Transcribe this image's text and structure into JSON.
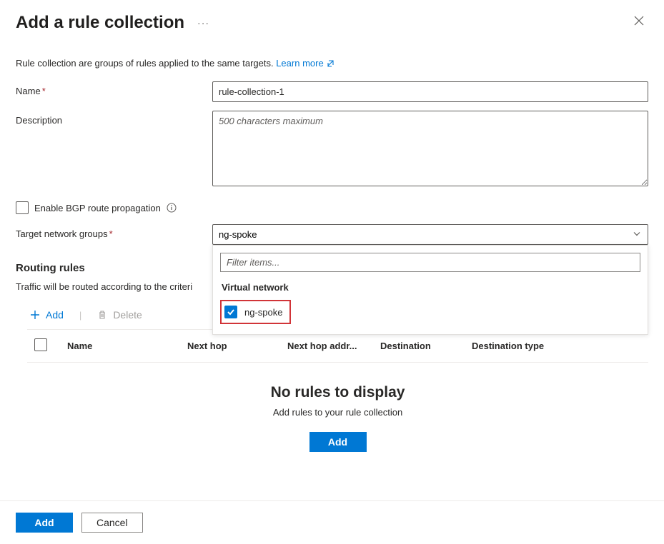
{
  "header": {
    "title": "Add a rule collection"
  },
  "intro": {
    "text": "Rule collection are groups of rules applied to the same targets. ",
    "learn_more": "Learn more"
  },
  "form": {
    "name_label": "Name",
    "name_value": "rule-collection-1",
    "desc_label": "Description",
    "desc_placeholder": "500 characters maximum",
    "bgp_label": "Enable BGP route propagation",
    "target_label": "Target network groups",
    "target_value": "ng-spoke"
  },
  "dropdown": {
    "filter_placeholder": "Filter items...",
    "group_label": "Virtual network",
    "item_label": "ng-spoke"
  },
  "routing": {
    "title": "Routing rules",
    "subtitle": "Traffic will be routed according to the criteri"
  },
  "toolbar": {
    "add_label": "Add",
    "delete_label": "Delete"
  },
  "table": {
    "col_name": "Name",
    "col_next": "Next hop",
    "col_addr": "Next hop addr...",
    "col_dest": "Destination",
    "col_dtype": "Destination type"
  },
  "empty": {
    "title": "No rules to display",
    "subtitle": "Add rules to your rule collection",
    "button": "Add"
  },
  "footer": {
    "add": "Add",
    "cancel": "Cancel"
  }
}
